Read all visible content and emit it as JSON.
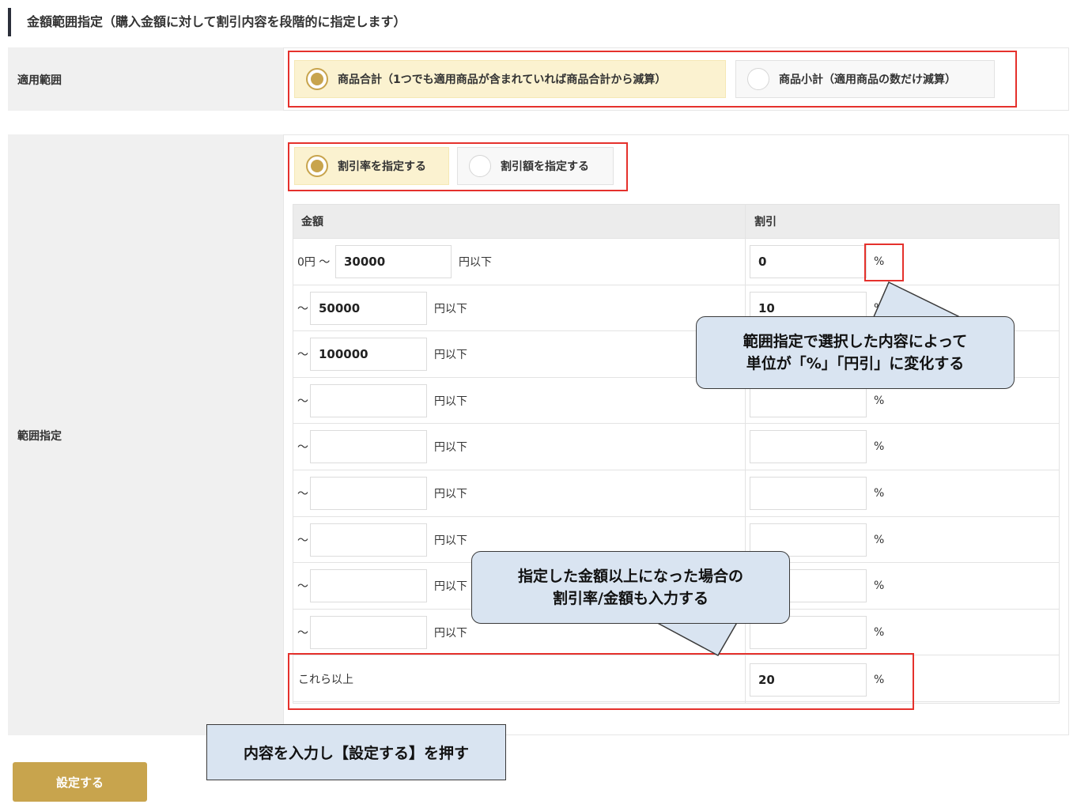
{
  "heading": "金額範囲指定（購入金額に対して割引内容を段階的に指定します）",
  "scope": {
    "label": "適用範囲",
    "options": [
      {
        "label": "商品合計（1つでも適用商品が含まれていれば商品合計から減算）",
        "selected": true
      },
      {
        "label": "商品小計（適用商品の数だけ減算）",
        "selected": false
      }
    ]
  },
  "range": {
    "label": "範囲指定",
    "type_options": [
      {
        "label": "割引率を指定する",
        "selected": true
      },
      {
        "label": "割引額を指定する",
        "selected": false
      }
    ],
    "table": {
      "col_amount": "金額",
      "col_discount": "割引",
      "first_prefix": "0円 〜",
      "prefix": "〜",
      "suffix": "円以下",
      "unit": "%",
      "rows": [
        {
          "amount": "30000",
          "discount": "0"
        },
        {
          "amount": "50000",
          "discount": "10"
        },
        {
          "amount": "100000",
          "discount": ""
        },
        {
          "amount": "",
          "discount": ""
        },
        {
          "amount": "",
          "discount": ""
        },
        {
          "amount": "",
          "discount": ""
        },
        {
          "amount": "",
          "discount": ""
        },
        {
          "amount": "",
          "discount": ""
        },
        {
          "amount": "",
          "discount": ""
        }
      ],
      "last_label": "これら以上",
      "last_discount": "20"
    }
  },
  "callouts": {
    "unit_line1": "範囲指定で選択した内容によって",
    "unit_line2": "単位が「%」「円引」に変化する",
    "above_line1": "指定した金額以上になった場合の",
    "above_line2": "割引率/金額も入力する",
    "submit_note": "内容を入力し【設定する】を押す"
  },
  "submit_label": "設定する",
  "colors": {
    "accent_gold": "#c8a44d",
    "selected_bg": "#fbf2d0",
    "highlight_red": "#e5312c",
    "callout_bg": "#d9e4f1"
  }
}
